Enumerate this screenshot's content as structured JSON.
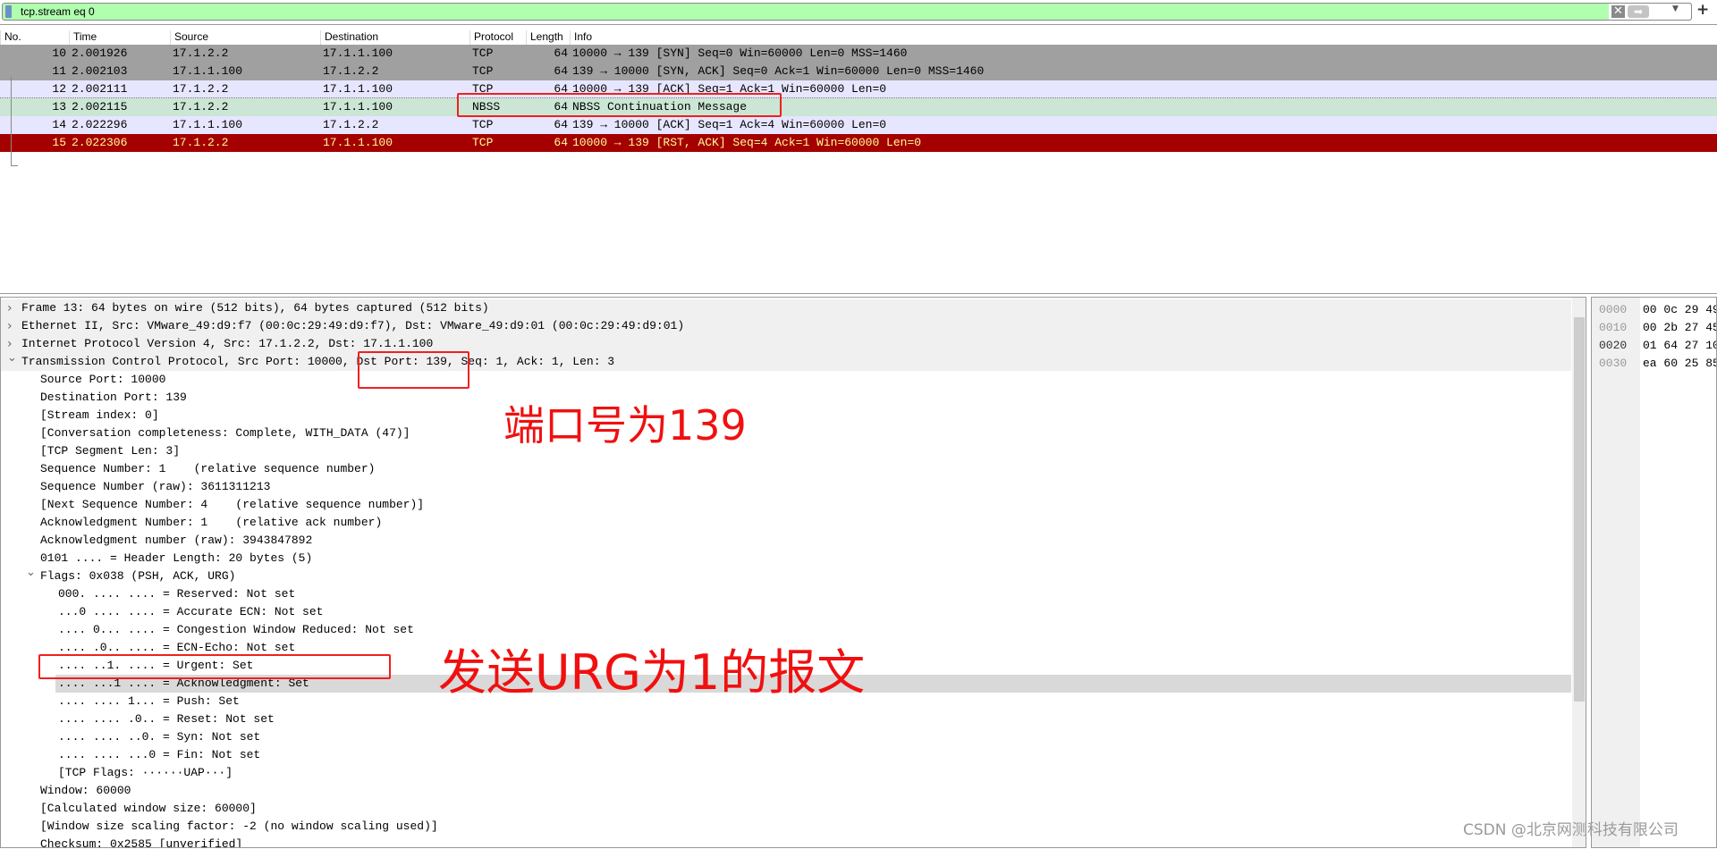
{
  "filter": {
    "value": "tcp.stream eq 0",
    "clear_icon": "close-icon",
    "apply_icon": "arrow-right-icon",
    "dropdown_icon": "caret-down-icon",
    "add_label": "+"
  },
  "packet_list": {
    "columns": [
      "No.",
      "Time",
      "Source",
      "Destination",
      "Protocol",
      "Length",
      "Info"
    ],
    "rows": [
      {
        "no": "10",
        "time": "2.001926",
        "src": "17.1.2.2",
        "dst": "17.1.1.100",
        "proto": "TCP",
        "len": "64",
        "info": "10000 → 139 [SYN] Seq=0 Win=60000 Len=0 MSS=1460",
        "bg": "#a0a0a0",
        "fg": "#000000"
      },
      {
        "no": "11",
        "time": "2.002103",
        "src": "17.1.1.100",
        "dst": "17.1.2.2",
        "proto": "TCP",
        "len": "64",
        "info": "139 → 10000 [SYN, ACK] Seq=0 Ack=1 Win=60000 Len=0 MSS=1460",
        "bg": "#a0a0a0",
        "fg": "#000000"
      },
      {
        "no": "12",
        "time": "2.002111",
        "src": "17.1.2.2",
        "dst": "17.1.1.100",
        "proto": "TCP",
        "len": "64",
        "info": "10000 → 139 [ACK] Seq=1 Ack=1 Win=60000 Len=0",
        "bg": "#e7e6ff",
        "fg": "#000000"
      },
      {
        "no": "13",
        "time": "2.002115",
        "src": "17.1.2.2",
        "dst": "17.1.1.100",
        "proto": "NBSS",
        "len": "64",
        "info": "NBSS Continuation Message",
        "bg": "#cbe6d4",
        "fg": "#000000"
      },
      {
        "no": "14",
        "time": "2.022296",
        "src": "17.1.1.100",
        "dst": "17.1.2.2",
        "proto": "TCP",
        "len": "64",
        "info": "139 → 10000 [ACK] Seq=1 Ack=4 Win=60000 Len=0",
        "bg": "#e7e6ff",
        "fg": "#000000"
      },
      {
        "no": "15",
        "time": "2.022306",
        "src": "17.1.2.2",
        "dst": "17.1.1.100",
        "proto": "TCP",
        "len": "64",
        "info": "10000 → 139 [RST, ACK] Seq=4 Ack=1 Win=60000 Len=0",
        "bg": "#a40000",
        "fg": "#fffc9c"
      }
    ]
  },
  "details": [
    {
      "t": "Frame 13: 64 bytes on wire (512 bits), 64 bytes captured (512 bits)",
      "lvl": 0,
      "exp": "collapsed"
    },
    {
      "t": "Ethernet II, Src: VMware_49:d9:f7 (00:0c:29:49:d9:f7), Dst: VMware_49:d9:01 (00:0c:29:49:d9:01)",
      "lvl": 0,
      "exp": "collapsed"
    },
    {
      "t": "Internet Protocol Version 4, Src: 17.1.2.2, Dst: 17.1.1.100",
      "lvl": 0,
      "exp": "collapsed"
    },
    {
      "t": "Transmission Control Protocol, Src Port: 10000, Dst Port: 139, Seq: 1, Ack: 1, Len: 3",
      "lvl": 0,
      "exp": "expanded"
    },
    {
      "t": "Source Port: 10000",
      "lvl": 1
    },
    {
      "t": "Destination Port: 139",
      "lvl": 1
    },
    {
      "t": "[Stream index: 0]",
      "lvl": 1
    },
    {
      "t": "[Conversation completeness: Complete, WITH_DATA (47)]",
      "lvl": 1
    },
    {
      "t": "[TCP Segment Len: 3]",
      "lvl": 1
    },
    {
      "t": "Sequence Number: 1    (relative sequence number)",
      "lvl": 1
    },
    {
      "t": "Sequence Number (raw): 3611311213",
      "lvl": 1
    },
    {
      "t": "[Next Sequence Number: 4    (relative sequence number)]",
      "lvl": 1
    },
    {
      "t": "Acknowledgment Number: 1    (relative ack number)",
      "lvl": 1
    },
    {
      "t": "Acknowledgment number (raw): 3943847892",
      "lvl": 1
    },
    {
      "t": "0101 .... = Header Length: 20 bytes (5)",
      "lvl": 1
    },
    {
      "t": "Flags: 0x038 (PSH, ACK, URG)",
      "lvl": 1,
      "exp": "expanded"
    },
    {
      "t": "000. .... .... = Reserved: Not set",
      "lvl": 2
    },
    {
      "t": "...0 .... .... = Accurate ECN: Not set",
      "lvl": 2
    },
    {
      "t": ".... 0... .... = Congestion Window Reduced: Not set",
      "lvl": 2
    },
    {
      "t": ".... .0.. .... = ECN-Echo: Not set",
      "lvl": 2
    },
    {
      "t": ".... ..1. .... = Urgent: Set",
      "lvl": 2
    },
    {
      "t": ".... ...1 .... = Acknowledgment: Set",
      "lvl": 2,
      "sel": true
    },
    {
      "t": ".... .... 1... = Push: Set",
      "lvl": 2
    },
    {
      "t": ".... .... .0.. = Reset: Not set",
      "lvl": 2
    },
    {
      "t": ".... .... ..0. = Syn: Not set",
      "lvl": 2
    },
    {
      "t": ".... .... ...0 = Fin: Not set",
      "lvl": 2
    },
    {
      "t": "[TCP Flags: ······UAP···]",
      "lvl": 2
    },
    {
      "t": "Window: 60000",
      "lvl": 1
    },
    {
      "t": "[Calculated window size: 60000]",
      "lvl": 1
    },
    {
      "t": "[Window size scaling factor: -2 (no window scaling used)]",
      "lvl": 1
    },
    {
      "t": "Checksum: 0x2585 [unverified]",
      "lvl": 1
    }
  ],
  "hex": [
    {
      "off": "0000",
      "bytes": "00 0c 29 49"
    },
    {
      "off": "0010",
      "bytes": "00 2b 27 45"
    },
    {
      "off": "0020",
      "bytes": "01 64 27 10"
    },
    {
      "off": "0030",
      "bytes": "ea 60 25 85"
    }
  ],
  "annotations": {
    "port": "端口号为139",
    "urg": "发送URG为1的报文"
  },
  "watermark": "CSDN @北京网测科技有限公司",
  "colors": {
    "filter_valid": "#afffaf",
    "annotation": "#f01010"
  }
}
